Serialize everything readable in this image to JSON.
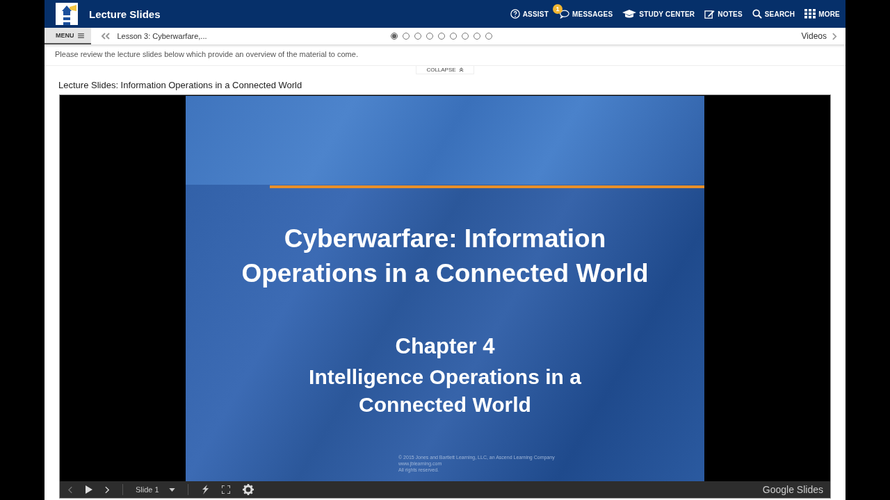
{
  "header": {
    "title": "Lecture Slides",
    "nav": [
      {
        "kind": "assist",
        "label": "ASSIST"
      },
      {
        "kind": "messages",
        "label": "MESSAGES",
        "badge": "1"
      },
      {
        "kind": "study",
        "label": "STUDY CENTER"
      },
      {
        "kind": "notes",
        "label": "NOTES"
      },
      {
        "kind": "search",
        "label": "SEARCH"
      },
      {
        "kind": "more",
        "label": "MORE"
      }
    ]
  },
  "subnav": {
    "menu": "MENU",
    "lesson": "Lesson 3: Cyberwarfare,...",
    "next": "Videos",
    "dots": [
      {
        "selected": true
      },
      {
        "selected": false
      },
      {
        "selected": false
      },
      {
        "selected": false
      },
      {
        "selected": false
      },
      {
        "selected": false
      },
      {
        "selected": false
      },
      {
        "selected": false
      },
      {
        "selected": false
      }
    ]
  },
  "intro": "Please review the lecture slides below which provide an overview of the material to come.",
  "collapse": "COLLAPSE",
  "section_title": "Lecture Slides: Information Operations in a Connected World",
  "slide": {
    "title_lines": [
      "Cyberwarfare: Information",
      "Operations in a Connected World"
    ],
    "chapter": "Chapter 4",
    "subtitle_lines": [
      "Intelligence Operations in a",
      "Connected World"
    ],
    "footer": [
      "© 2015 Jones and Bartlett Learning, LLC, an Ascend Learning Company",
      "www.jblearning.com",
      "All rights reserved."
    ]
  },
  "player": {
    "slide_label": "Slide 1",
    "brand": "Google Slides"
  }
}
